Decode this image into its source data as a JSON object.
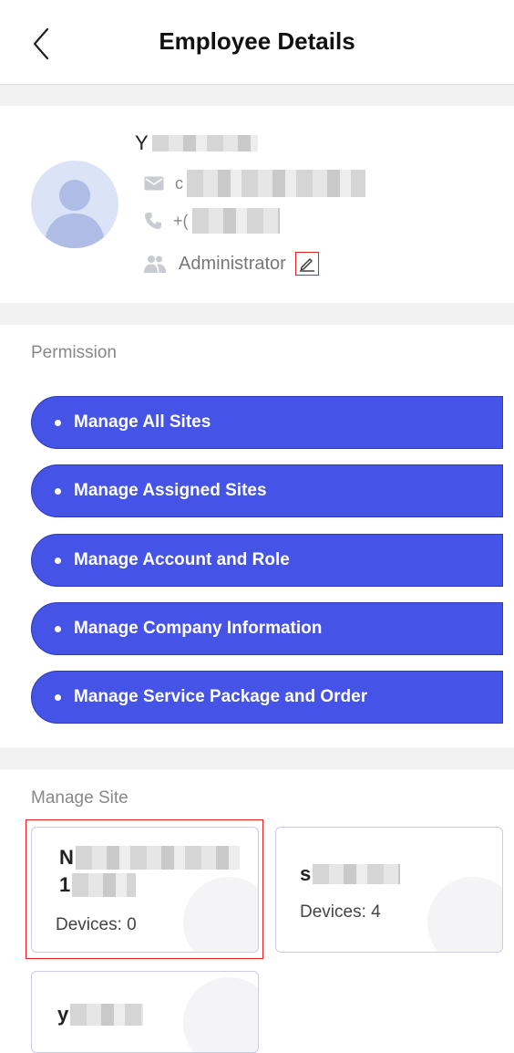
{
  "header": {
    "title": "Employee Details"
  },
  "profile": {
    "name_initial": "Y",
    "email_prefix": "c",
    "phone_prefix": "+(",
    "role": "Administrator"
  },
  "permission": {
    "label": "Permission",
    "items": [
      "Manage All Sites",
      "Manage Assigned Sites",
      "Manage Account and Role",
      "Manage Company Information",
      "Manage Service Package and Order"
    ]
  },
  "manage_site": {
    "label": "Manage Site",
    "cards": [
      {
        "name_initial": "N",
        "name_line2_initial": "1",
        "devices": "Devices: 0"
      },
      {
        "name_initial": "s",
        "devices": "Devices: 4"
      },
      {
        "name_initial": "y"
      }
    ]
  },
  "colors": {
    "accent": "#4553e6",
    "highlight": "#e02020"
  }
}
